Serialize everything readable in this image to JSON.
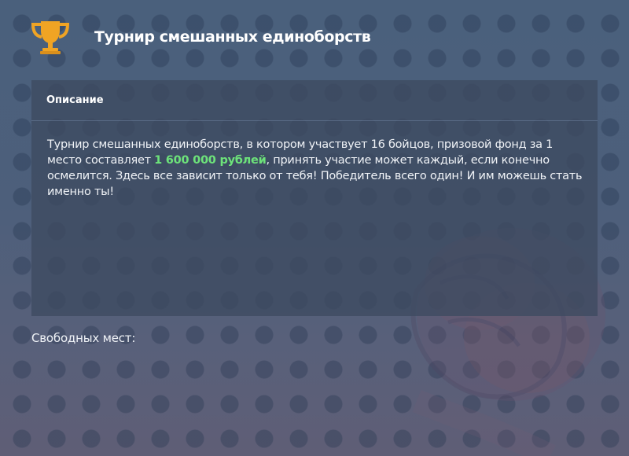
{
  "header": {
    "title": "Турнир смешанных единоборств",
    "icon": "trophy-icon",
    "icon_color": "#f0a424"
  },
  "description_panel": {
    "heading": "Описание",
    "text_before": "Турнир смешанных единоборств, в котором участвует 16 бойцов, призовой фонд за 1 место составляет ",
    "prize_amount": "1 600 000 рублей",
    "text_after": ", принять участие может каждый, если конечно осмелится. Здесь все зависит только от тебя! Победитель всего один! И им можешь стать именно ты!",
    "prize_color": "#6de37a"
  },
  "free_places": {
    "label": "Свободных мест:"
  }
}
